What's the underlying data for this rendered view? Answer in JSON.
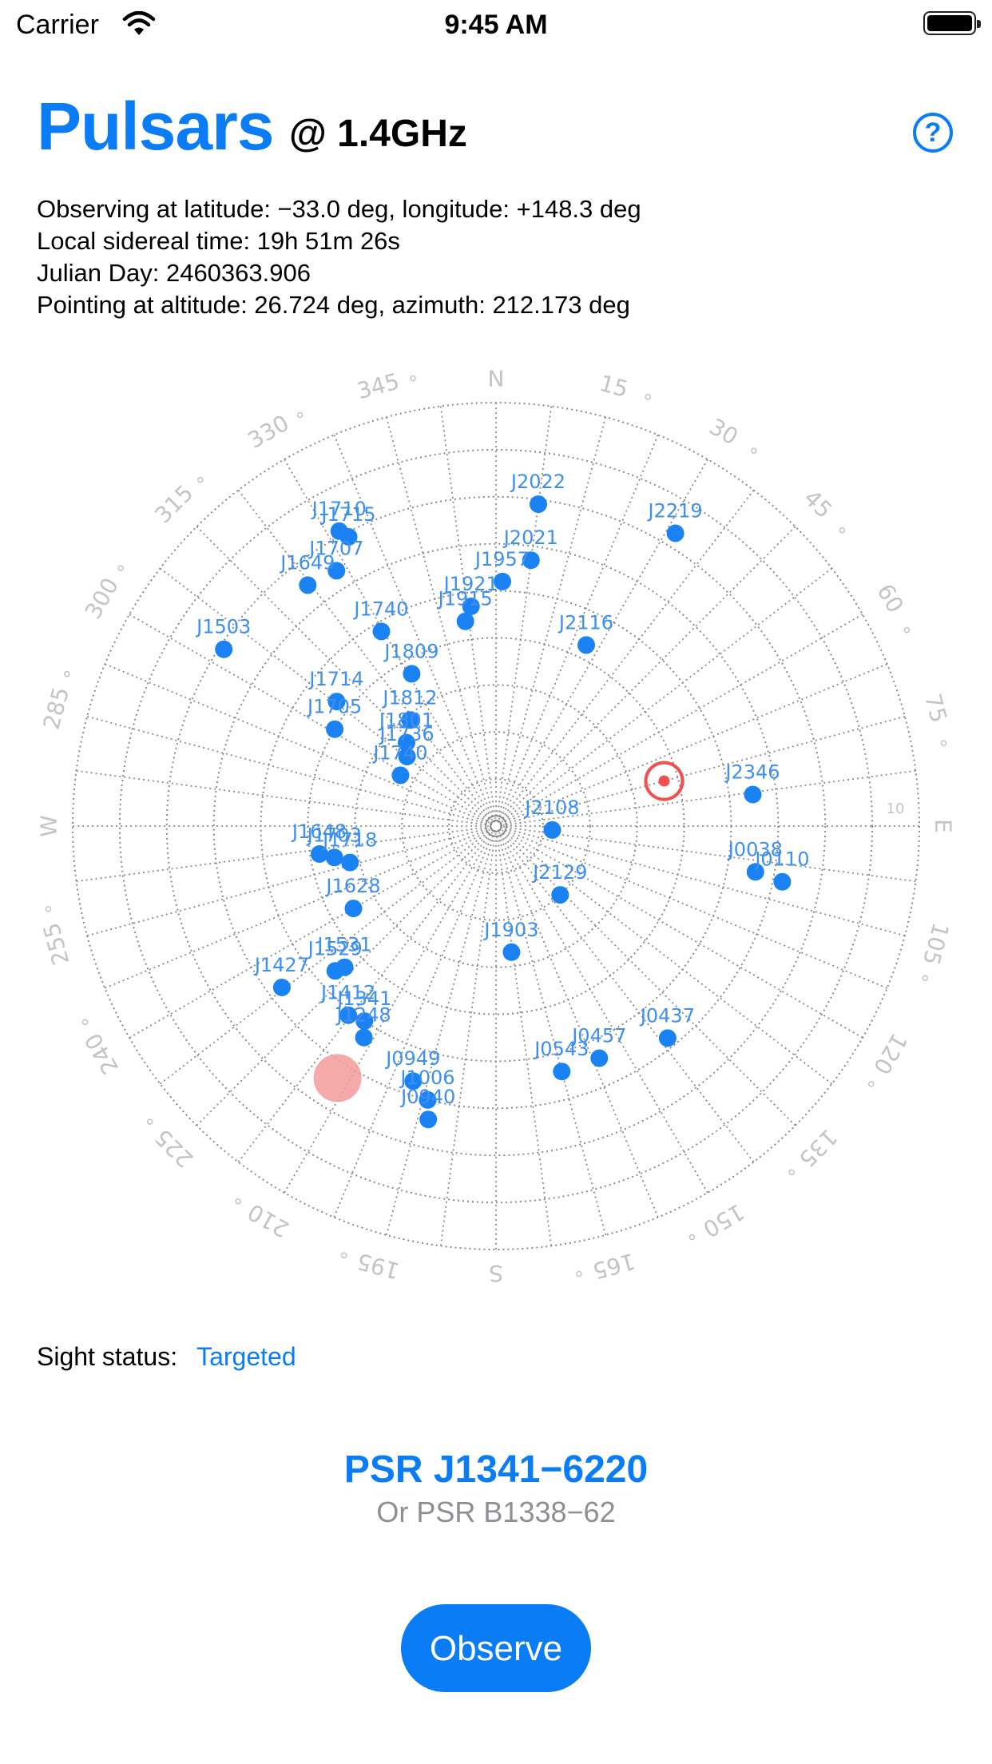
{
  "status_bar": {
    "carrier": "Carrier",
    "time": "9:45 AM"
  },
  "header": {
    "title": "Pulsars",
    "band": "@ 1.4GHz",
    "help_symbol": "?"
  },
  "info": {
    "line1": "Observing at latitude: −33.0 deg,   longitude: +148.3 deg",
    "line2": "Local sidereal time: 19h 51m 26s",
    "line3": "Julian Day: 2460363.906",
    "line4": "Pointing at altitude: 26.724 deg,   azimuth: 212.173 deg"
  },
  "sky_chart": {
    "compass": [
      "N",
      "E",
      "S",
      "W"
    ],
    "azimuth_labels": [
      "15",
      "30",
      "45",
      "60",
      "75",
      "105",
      "120",
      "135",
      "150",
      "165",
      "195",
      "210",
      "225",
      "240",
      "255",
      "285",
      "300",
      "315",
      "330",
      "345"
    ],
    "ring_label": "10",
    "colors": {
      "pulsar": "#1a82f2",
      "label": "#3d8ff0",
      "grid": "#8a8a8a",
      "target": "#f05050",
      "selected": "#f39a9a"
    },
    "target": {
      "azimuth": 75,
      "altitude": 53
    },
    "selected": {
      "azimuth": 212.173,
      "altitude": 26.724
    },
    "pulsars": [
      {
        "name": "J2022",
        "az": 7.5,
        "alt": 21
      },
      {
        "name": "J2219",
        "az": 31.5,
        "alt": 17
      },
      {
        "name": "J2021",
        "az": 7.5,
        "alt": 33
      },
      {
        "name": "J1957",
        "az": 1.5,
        "alt": 38
      },
      {
        "name": "J1921",
        "az": -6.5,
        "alt": 43
      },
      {
        "name": "J1915",
        "az": -8.5,
        "alt": 46
      },
      {
        "name": "J2116",
        "az": 26.5,
        "alt": 47
      },
      {
        "name": "J1710",
        "az": -28,
        "alt": 19
      },
      {
        "name": "J1715",
        "az": -27,
        "alt": 21
      },
      {
        "name": "J1707",
        "az": -32,
        "alt": 26
      },
      {
        "name": "J1649",
        "az": -38,
        "alt": 25
      },
      {
        "name": "J1740",
        "az": -30.5,
        "alt": 42
      },
      {
        "name": "J1503",
        "az": -57,
        "alt": 21
      },
      {
        "name": "J1809",
        "az": -29,
        "alt": 53
      },
      {
        "name": "J1714",
        "az": -52,
        "alt": 47
      },
      {
        "name": "J1812",
        "az": -39,
        "alt": 61
      },
      {
        "name": "J1705",
        "az": -59,
        "alt": 50
      },
      {
        "name": "J1801",
        "az": -47,
        "alt": 64
      },
      {
        "name": "J1736",
        "az": -52,
        "alt": 66
      },
      {
        "name": "J1740",
        "az": -62,
        "alt": 67
      },
      {
        "name": "J1648",
        "az": -99,
        "alt": 52
      },
      {
        "name": "J1703",
        "az": -101,
        "alt": 55
      },
      {
        "name": "J1718",
        "az": -104,
        "alt": 58
      },
      {
        "name": "J2346",
        "az": 83,
        "alt": 35
      },
      {
        "name": "J2108",
        "az": 94,
        "alt": 78
      },
      {
        "name": "J0038",
        "az": 100,
        "alt": 34
      },
      {
        "name": "J0110",
        "az": 101,
        "alt": 28
      },
      {
        "name": "J1628",
        "az": -120,
        "alt": 55
      },
      {
        "name": "J2129",
        "az": 137,
        "alt": 70
      },
      {
        "name": "J1427",
        "az": -127,
        "alt": 33
      },
      {
        "name": "J1529",
        "az": -132,
        "alt": 44
      },
      {
        "name": "J1531",
        "az": -133,
        "alt": 46
      },
      {
        "name": "J1903",
        "az": 173,
        "alt": 63
      },
      {
        "name": "J1412",
        "az": -142,
        "alt": 39
      },
      {
        "name": "J1341",
        "az": -146,
        "alt": 40
      },
      {
        "name": "J1248",
        "az": -148,
        "alt": 37
      },
      {
        "name": "J0949",
        "az": -162,
        "alt": 33
      },
      {
        "name": "J1006",
        "az": -166,
        "alt": 30
      },
      {
        "name": "J0940",
        "az": -167,
        "alt": 26
      },
      {
        "name": "J0543",
        "az": 165,
        "alt": 36
      },
      {
        "name": "J0457",
        "az": 156,
        "alt": 36
      },
      {
        "name": "J0437",
        "az": 141,
        "alt": 32
      }
    ]
  },
  "sight": {
    "label": "Sight status:",
    "value": "Targeted"
  },
  "pulsar": {
    "name": "PSR J1341−6220",
    "alt_name": "Or PSR B1338−62"
  },
  "actions": {
    "observe": "Observe"
  }
}
